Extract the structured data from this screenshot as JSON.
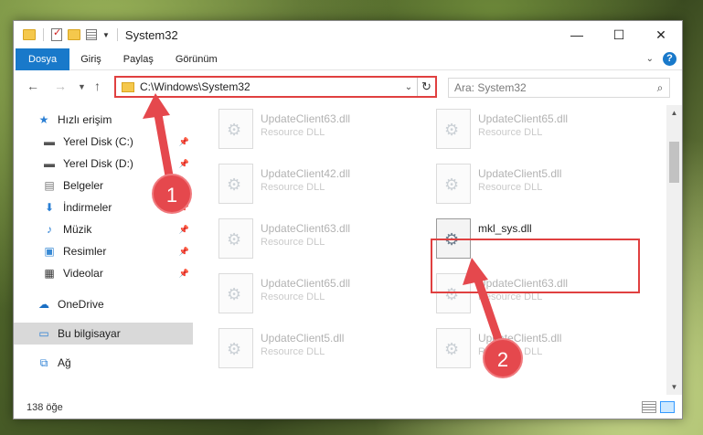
{
  "window": {
    "title": "System32"
  },
  "window_controls": {
    "minimize": "—",
    "maximize": "☐",
    "close": "✕"
  },
  "ribbon": {
    "tabs": [
      "Dosya",
      "Giriş",
      "Paylaş",
      "Görünüm"
    ],
    "help": "?"
  },
  "address": {
    "path": "C:\\Windows\\System32"
  },
  "search": {
    "placeholder": "Ara: System32"
  },
  "sidebar": {
    "items": [
      {
        "label": "Hızlı erişim",
        "icon": "star-icon"
      },
      {
        "label": "Yerel Disk (C:)",
        "icon": "drive-icon",
        "pinned": true
      },
      {
        "label": "Yerel Disk (D:)",
        "icon": "drive-icon",
        "pinned": true
      },
      {
        "label": "Belgeler",
        "icon": "documents-icon",
        "pinned": true
      },
      {
        "label": "İndirmeler",
        "icon": "downloads-icon",
        "pinned": true
      },
      {
        "label": "Müzik",
        "icon": "music-icon",
        "pinned": true
      },
      {
        "label": "Resimler",
        "icon": "pictures-icon",
        "pinned": true
      },
      {
        "label": "Videolar",
        "icon": "videos-icon",
        "pinned": true
      },
      {
        "label": "OneDrive",
        "icon": "cloud-icon"
      },
      {
        "label": "Bu bilgisayar",
        "icon": "computer-icon",
        "selected": true
      },
      {
        "label": "Ağ",
        "icon": "network-icon"
      }
    ]
  },
  "files": [
    {
      "name": "UpdateClient63.dll",
      "type": "Resource DLL"
    },
    {
      "name": "UpdateClient65.dll",
      "type": "Resource DLL"
    },
    {
      "name": "UpdateClient42.dll",
      "type": "Resource DLL"
    },
    {
      "name": "UpdateClient5.dll",
      "type": "Resource DLL"
    },
    {
      "name": "UpdateClient63.dll",
      "type": "Resource DLL"
    },
    {
      "name": "mkl_sys.dll",
      "type": "",
      "highlighted": true
    },
    {
      "name": "UpdateClient65.dll",
      "type": "Resource DLL"
    },
    {
      "name": "UpdateClient63.dll",
      "type": "Resource DLL"
    },
    {
      "name": "UpdateClient5.dll",
      "type": "Resource DLL"
    },
    {
      "name": "UpdateClient5.dll",
      "type": "Resource DLL"
    }
  ],
  "status": {
    "count": "138 öğe"
  },
  "annotations": {
    "step1": "1",
    "step2": "2",
    "color": "#e5484d"
  }
}
